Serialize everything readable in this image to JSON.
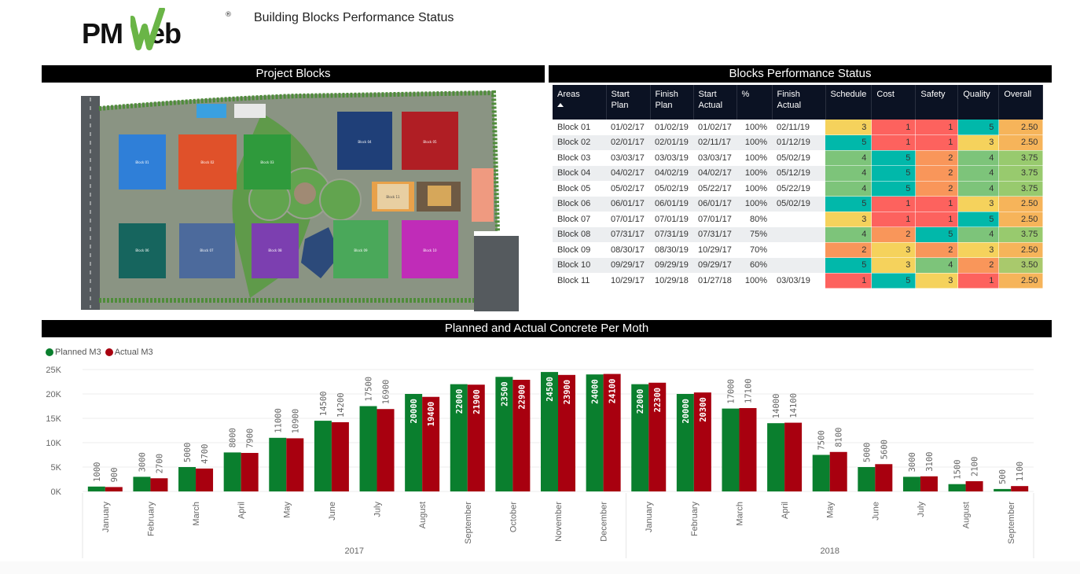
{
  "header": {
    "logo_text_left": "PM",
    "logo_text_right": "eb",
    "logo_registered": "®",
    "title": "Building Blocks Performance Status"
  },
  "sections": {
    "project_blocks": "Project Blocks",
    "performance_status": "Blocks Performance Status",
    "concrete_chart": "Planned and Actual Concrete Per Moth"
  },
  "map": {
    "blocks": [
      {
        "name": "Block 01",
        "color": "#2f7fd8"
      },
      {
        "name": "Block 02",
        "color": "#e0512a"
      },
      {
        "name": "Block 03",
        "color": "#2f9a3c"
      },
      {
        "name": "Block 04",
        "color": "#1f3f78"
      },
      {
        "name": "Block 05",
        "color": "#b01e24"
      },
      {
        "name": "Block 06",
        "color": "#16655e"
      },
      {
        "name": "Block 07",
        "color": "#4c6a9c"
      },
      {
        "name": "Block 08",
        "color": "#7c3fb0"
      },
      {
        "name": "Block 09",
        "color": "#4aa85a"
      },
      {
        "name": "Block 10",
        "color": "#c02cb8"
      },
      {
        "name": "Block 11",
        "color": "#e8a14a"
      }
    ]
  },
  "table": {
    "columns": [
      "Areas",
      "Start Plan",
      "Finish Plan",
      "Start Actual",
      "%",
      "Finish Actual",
      "Schedule",
      "Cost",
      "Safety",
      "Quality",
      "Overall"
    ],
    "sort_column": "Areas",
    "sort_direction": "ascending",
    "score_colors": {
      "1": "#fd625e",
      "2": "#f9965a",
      "3": "#f5d25c",
      "4": "#7dc47a",
      "5": "#01b8aa"
    },
    "overall_colors": {
      "2.50": "#f6b45a",
      "3.50": "#a9c96c",
      "3.75": "#98ca6e"
    },
    "rows": [
      {
        "area": "Block 01",
        "start_plan": "01/02/17",
        "finish_plan": "01/02/19",
        "start_actual": "01/02/17",
        "pct": "100%",
        "finish_actual": "02/11/19",
        "schedule": "3",
        "cost": "1",
        "safety": "1",
        "quality": "5",
        "overall": "2.50"
      },
      {
        "area": "Block 02",
        "start_plan": "02/01/17",
        "finish_plan": "02/01/19",
        "start_actual": "02/11/17",
        "pct": "100%",
        "finish_actual": "01/12/19",
        "schedule": "5",
        "cost": "1",
        "safety": "1",
        "quality": "3",
        "overall": "2.50"
      },
      {
        "area": "Block 03",
        "start_plan": "03/03/17",
        "finish_plan": "03/03/19",
        "start_actual": "03/03/17",
        "pct": "100%",
        "finish_actual": "05/02/19",
        "schedule": "4",
        "cost": "5",
        "safety": "2",
        "quality": "4",
        "overall": "3.75"
      },
      {
        "area": "Block 04",
        "start_plan": "04/02/17",
        "finish_plan": "04/02/19",
        "start_actual": "04/02/17",
        "pct": "100%",
        "finish_actual": "05/12/19",
        "schedule": "4",
        "cost": "5",
        "safety": "2",
        "quality": "4",
        "overall": "3.75"
      },
      {
        "area": "Block 05",
        "start_plan": "05/02/17",
        "finish_plan": "05/02/19",
        "start_actual": "05/22/17",
        "pct": "100%",
        "finish_actual": "05/22/19",
        "schedule": "4",
        "cost": "5",
        "safety": "2",
        "quality": "4",
        "overall": "3.75"
      },
      {
        "area": "Block 06",
        "start_plan": "06/01/17",
        "finish_plan": "06/01/19",
        "start_actual": "06/01/17",
        "pct": "100%",
        "finish_actual": "05/02/19",
        "schedule": "5",
        "cost": "1",
        "safety": "1",
        "quality": "3",
        "overall": "2.50"
      },
      {
        "area": "Block 07",
        "start_plan": "07/01/17",
        "finish_plan": "07/01/19",
        "start_actual": "07/01/17",
        "pct": "80%",
        "finish_actual": "",
        "schedule": "3",
        "cost": "1",
        "safety": "1",
        "quality": "5",
        "overall": "2.50"
      },
      {
        "area": "Block 08",
        "start_plan": "07/31/17",
        "finish_plan": "07/31/19",
        "start_actual": "07/31/17",
        "pct": "75%",
        "finish_actual": "",
        "schedule": "4",
        "cost": "2",
        "safety": "5",
        "quality": "4",
        "overall": "3.75"
      },
      {
        "area": "Block 09",
        "start_plan": "08/30/17",
        "finish_plan": "08/30/19",
        "start_actual": "10/29/17",
        "pct": "70%",
        "finish_actual": "",
        "schedule": "2",
        "cost": "3",
        "safety": "2",
        "quality": "3",
        "overall": "2.50"
      },
      {
        "area": "Block 10",
        "start_plan": "09/29/17",
        "finish_plan": "09/29/19",
        "start_actual": "09/29/17",
        "pct": "60%",
        "finish_actual": "",
        "schedule": "5",
        "cost": "3",
        "safety": "4",
        "quality": "2",
        "overall": "3.50"
      },
      {
        "area": "Block 11",
        "start_plan": "10/29/17",
        "finish_plan": "10/29/18",
        "start_actual": "01/27/18",
        "pct": "100%",
        "finish_actual": "03/03/19",
        "schedule": "1",
        "cost": "5",
        "safety": "3",
        "quality": "1",
        "overall": "2.50"
      }
    ]
  },
  "chart_data": {
    "type": "bar",
    "title": "Planned and Actual Concrete Per Moth",
    "xlabel": "",
    "ylabel": "",
    "ylim": [
      0,
      25000
    ],
    "yticks": [
      "0K",
      "5K",
      "10K",
      "15K",
      "20K",
      "25K"
    ],
    "grid": true,
    "legend_position": "top-left",
    "categories": [
      "January",
      "February",
      "March",
      "April",
      "May",
      "June",
      "July",
      "August",
      "September",
      "October",
      "November",
      "December",
      "January",
      "February",
      "March",
      "April",
      "May",
      "June",
      "July",
      "August",
      "September"
    ],
    "groups": [
      {
        "label": "2017",
        "count": 12
      },
      {
        "label": "2018",
        "count": 9
      }
    ],
    "series": [
      {
        "name": "Planned M3",
        "color": "#0a7f2e",
        "values": [
          1000,
          3000,
          5000,
          8000,
          11000,
          14500,
          17500,
          20000,
          22000,
          23500,
          24500,
          24000,
          22000,
          20000,
          17000,
          14000,
          7500,
          5000,
          3000,
          1500,
          500
        ]
      },
      {
        "name": "Actual M3",
        "color": "#a8000f",
        "values": [
          900,
          2700,
          4700,
          7900,
          10900,
          14200,
          16900,
          19400,
          21900,
          22900,
          23900,
          24100,
          22300,
          20300,
          17100,
          14100,
          8100,
          5600,
          3100,
          2100,
          1100
        ]
      }
    ]
  }
}
